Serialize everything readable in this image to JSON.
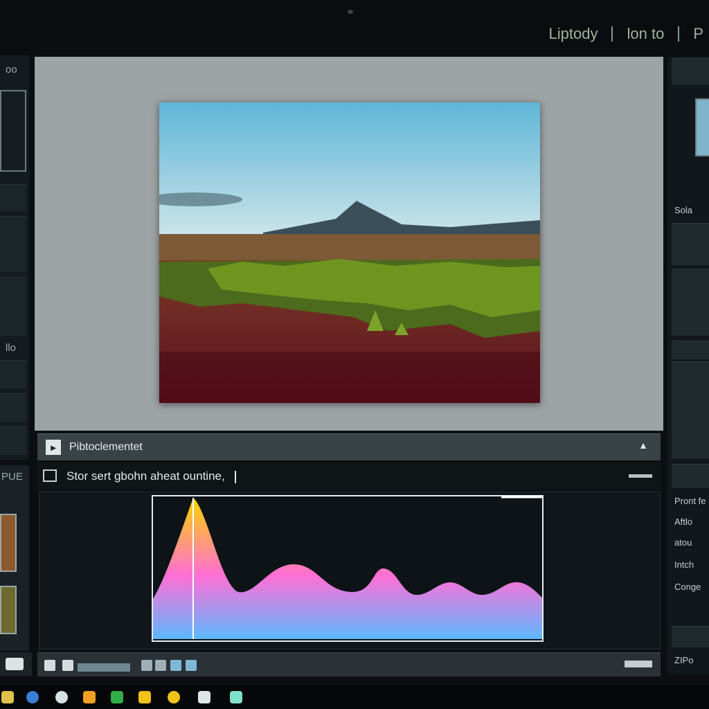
{
  "app": {
    "top_menu": [
      "Liptody",
      "lon to",
      "P"
    ]
  },
  "left_panel": {
    "labels": [
      "oo",
      "llo",
      "PUE"
    ]
  },
  "status": {
    "label": "Pibtoclementet"
  },
  "info": {
    "text": "Stor sert gbohn aheat ountine,"
  },
  "right_panel": {
    "labels": [
      "Sola",
      "Pront fe",
      "Aftlo",
      "atou",
      "Intch",
      "Conge",
      "ZIPo"
    ]
  },
  "colors": {
    "accent": "#9fb39e",
    "canvas": "#9ea4a6",
    "histogram_gradient": [
      "#ffd400",
      "#ff6fd6",
      "#5cb8ff"
    ]
  },
  "icons": {
    "status": "photo-icon",
    "info": "folder-icon",
    "camera": "camera-icon"
  }
}
